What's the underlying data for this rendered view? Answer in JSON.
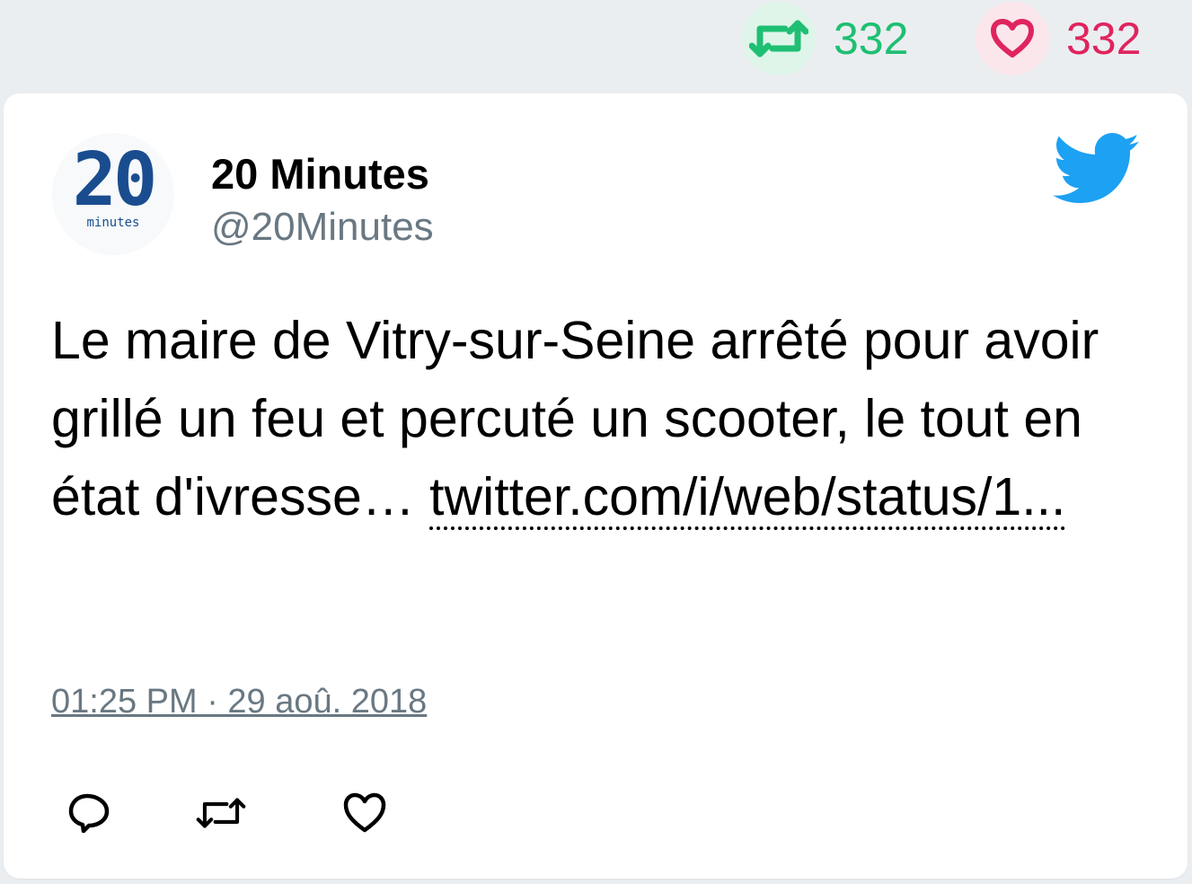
{
  "stats": {
    "retweet_count": "332",
    "like_count": "332",
    "retweet_color": "#1fbf73",
    "like_color": "#e0245e"
  },
  "tweet": {
    "avatar_icon": "20-minutes-logo",
    "avatar_logo_text": "20",
    "avatar_logo_subtext": "minutes",
    "display_name": "20 Minutes",
    "handle": "@20Minutes",
    "text": "Le maire de Vitry-sur-Seine arrêté pour avoir grillé un feu et percuté un scooter, le tout en état d'ivresse… ",
    "link_text": "twitter.com/i/web/status/1...",
    "timestamp": "01:25 PM · 29 aoû. 2018",
    "platform_icon": "twitter-bird-icon",
    "brand_color": "#1da1f2"
  },
  "actions": [
    {
      "icon": "reply-icon"
    },
    {
      "icon": "retweet-icon"
    },
    {
      "icon": "like-icon"
    }
  ]
}
